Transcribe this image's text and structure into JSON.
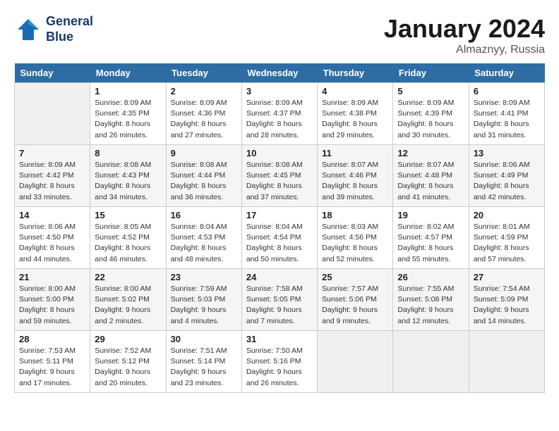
{
  "header": {
    "logo_line1": "General",
    "logo_line2": "Blue",
    "month": "January 2024",
    "location": "Almaznyy, Russia"
  },
  "days_of_week": [
    "Sunday",
    "Monday",
    "Tuesday",
    "Wednesday",
    "Thursday",
    "Friday",
    "Saturday"
  ],
  "weeks": [
    [
      {
        "day": "",
        "empty": true
      },
      {
        "day": "1",
        "sunrise": "Sunrise: 8:09 AM",
        "sunset": "Sunset: 4:35 PM",
        "daylight": "Daylight: 8 hours and 26 minutes."
      },
      {
        "day": "2",
        "sunrise": "Sunrise: 8:09 AM",
        "sunset": "Sunset: 4:36 PM",
        "daylight": "Daylight: 8 hours and 27 minutes."
      },
      {
        "day": "3",
        "sunrise": "Sunrise: 8:09 AM",
        "sunset": "Sunset: 4:37 PM",
        "daylight": "Daylight: 8 hours and 28 minutes."
      },
      {
        "day": "4",
        "sunrise": "Sunrise: 8:09 AM",
        "sunset": "Sunset: 4:38 PM",
        "daylight": "Daylight: 8 hours and 29 minutes."
      },
      {
        "day": "5",
        "sunrise": "Sunrise: 8:09 AM",
        "sunset": "Sunset: 4:39 PM",
        "daylight": "Daylight: 8 hours and 30 minutes."
      },
      {
        "day": "6",
        "sunrise": "Sunrise: 8:09 AM",
        "sunset": "Sunset: 4:41 PM",
        "daylight": "Daylight: 8 hours and 31 minutes."
      }
    ],
    [
      {
        "day": "7",
        "sunrise": "Sunrise: 8:09 AM",
        "sunset": "Sunset: 4:42 PM",
        "daylight": "Daylight: 8 hours and 33 minutes."
      },
      {
        "day": "8",
        "sunrise": "Sunrise: 8:08 AM",
        "sunset": "Sunset: 4:43 PM",
        "daylight": "Daylight: 8 hours and 34 minutes."
      },
      {
        "day": "9",
        "sunrise": "Sunrise: 8:08 AM",
        "sunset": "Sunset: 4:44 PM",
        "daylight": "Daylight: 8 hours and 36 minutes."
      },
      {
        "day": "10",
        "sunrise": "Sunrise: 8:08 AM",
        "sunset": "Sunset: 4:45 PM",
        "daylight": "Daylight: 8 hours and 37 minutes."
      },
      {
        "day": "11",
        "sunrise": "Sunrise: 8:07 AM",
        "sunset": "Sunset: 4:46 PM",
        "daylight": "Daylight: 8 hours and 39 minutes."
      },
      {
        "day": "12",
        "sunrise": "Sunrise: 8:07 AM",
        "sunset": "Sunset: 4:48 PM",
        "daylight": "Daylight: 8 hours and 41 minutes."
      },
      {
        "day": "13",
        "sunrise": "Sunrise: 8:06 AM",
        "sunset": "Sunset: 4:49 PM",
        "daylight": "Daylight: 8 hours and 42 minutes."
      }
    ],
    [
      {
        "day": "14",
        "sunrise": "Sunrise: 8:06 AM",
        "sunset": "Sunset: 4:50 PM",
        "daylight": "Daylight: 8 hours and 44 minutes."
      },
      {
        "day": "15",
        "sunrise": "Sunrise: 8:05 AM",
        "sunset": "Sunset: 4:52 PM",
        "daylight": "Daylight: 8 hours and 46 minutes."
      },
      {
        "day": "16",
        "sunrise": "Sunrise: 8:04 AM",
        "sunset": "Sunset: 4:53 PM",
        "daylight": "Daylight: 8 hours and 48 minutes."
      },
      {
        "day": "17",
        "sunrise": "Sunrise: 8:04 AM",
        "sunset": "Sunset: 4:54 PM",
        "daylight": "Daylight: 8 hours and 50 minutes."
      },
      {
        "day": "18",
        "sunrise": "Sunrise: 8:03 AM",
        "sunset": "Sunset: 4:56 PM",
        "daylight": "Daylight: 8 hours and 52 minutes."
      },
      {
        "day": "19",
        "sunrise": "Sunrise: 8:02 AM",
        "sunset": "Sunset: 4:57 PM",
        "daylight": "Daylight: 8 hours and 55 minutes."
      },
      {
        "day": "20",
        "sunrise": "Sunrise: 8:01 AM",
        "sunset": "Sunset: 4:59 PM",
        "daylight": "Daylight: 8 hours and 57 minutes."
      }
    ],
    [
      {
        "day": "21",
        "sunrise": "Sunrise: 8:00 AM",
        "sunset": "Sunset: 5:00 PM",
        "daylight": "Daylight: 8 hours and 59 minutes."
      },
      {
        "day": "22",
        "sunrise": "Sunrise: 8:00 AM",
        "sunset": "Sunset: 5:02 PM",
        "daylight": "Daylight: 9 hours and 2 minutes."
      },
      {
        "day": "23",
        "sunrise": "Sunrise: 7:59 AM",
        "sunset": "Sunset: 5:03 PM",
        "daylight": "Daylight: 9 hours and 4 minutes."
      },
      {
        "day": "24",
        "sunrise": "Sunrise: 7:58 AM",
        "sunset": "Sunset: 5:05 PM",
        "daylight": "Daylight: 9 hours and 7 minutes."
      },
      {
        "day": "25",
        "sunrise": "Sunrise: 7:57 AM",
        "sunset": "Sunset: 5:06 PM",
        "daylight": "Daylight: 9 hours and 9 minutes."
      },
      {
        "day": "26",
        "sunrise": "Sunrise: 7:55 AM",
        "sunset": "Sunset: 5:08 PM",
        "daylight": "Daylight: 9 hours and 12 minutes."
      },
      {
        "day": "27",
        "sunrise": "Sunrise: 7:54 AM",
        "sunset": "Sunset: 5:09 PM",
        "daylight": "Daylight: 9 hours and 14 minutes."
      }
    ],
    [
      {
        "day": "28",
        "sunrise": "Sunrise: 7:53 AM",
        "sunset": "Sunset: 5:11 PM",
        "daylight": "Daylight: 9 hours and 17 minutes."
      },
      {
        "day": "29",
        "sunrise": "Sunrise: 7:52 AM",
        "sunset": "Sunset: 5:12 PM",
        "daylight": "Daylight: 9 hours and 20 minutes."
      },
      {
        "day": "30",
        "sunrise": "Sunrise: 7:51 AM",
        "sunset": "Sunset: 5:14 PM",
        "daylight": "Daylight: 9 hours and 23 minutes."
      },
      {
        "day": "31",
        "sunrise": "Sunrise: 7:50 AM",
        "sunset": "Sunset: 5:16 PM",
        "daylight": "Daylight: 9 hours and 26 minutes."
      },
      {
        "day": "",
        "empty": true
      },
      {
        "day": "",
        "empty": true
      },
      {
        "day": "",
        "empty": true
      }
    ]
  ]
}
